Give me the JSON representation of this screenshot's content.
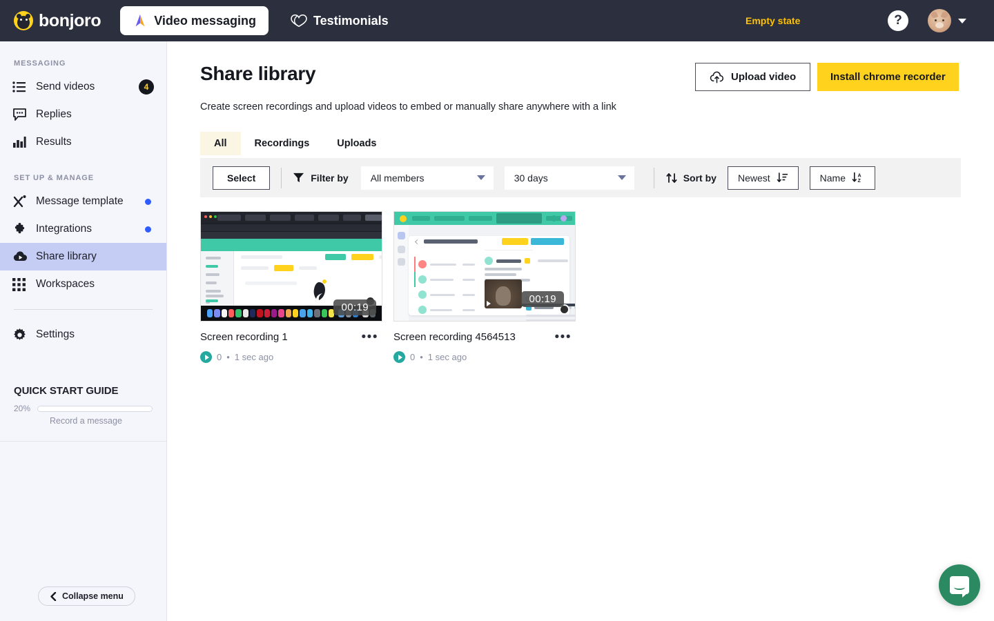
{
  "topbar": {
    "brand": "bonjoro",
    "nav": [
      {
        "label": "Video messaging",
        "icon": "paper-plane-icon",
        "active": true
      },
      {
        "label": "Testimonials",
        "icon": "heart-ribbon-icon",
        "active": false
      }
    ],
    "empty_state_link": "Empty state",
    "help_icon": "question-mark-icon",
    "avatar": "user-avatar",
    "caret": "chevron-down-icon",
    "bg_color": "#2b2f3e",
    "accent_color": "#ffc107"
  },
  "sidebar": {
    "sections": [
      {
        "title": "MESSAGING",
        "items": [
          {
            "label": "Send videos",
            "icon": "list-icon",
            "badge": "4",
            "dot": false,
            "active": false
          },
          {
            "label": "Replies",
            "icon": "chat-bubble-icon",
            "badge": null,
            "dot": false,
            "active": false
          },
          {
            "label": "Results",
            "icon": "bar-chart-icon",
            "badge": null,
            "dot": false,
            "active": false
          }
        ]
      },
      {
        "title": "SET UP & MANAGE",
        "items": [
          {
            "label": "Message template",
            "icon": "wand-icon",
            "badge": null,
            "dot": true,
            "active": false
          },
          {
            "label": "Integrations",
            "icon": "puzzle-icon",
            "badge": null,
            "dot": true,
            "active": false
          },
          {
            "label": "Share library",
            "icon": "cloud-play-icon",
            "badge": null,
            "dot": false,
            "active": true
          },
          {
            "label": "Workspaces",
            "icon": "grid-icon",
            "badge": null,
            "dot": false,
            "active": false
          }
        ]
      }
    ],
    "settings": {
      "label": "Settings",
      "icon": "gear-icon"
    },
    "quick_start": {
      "title": "QUICK START GUIDE",
      "percent_label": "20%",
      "percent_value": 20,
      "next_step": "Record a message"
    },
    "collapse": {
      "label": "Collapse menu",
      "icon": "chevron-left-icon"
    },
    "active_bg": "#c6cdf5",
    "bg_color": "#f5f6fb"
  },
  "main": {
    "page_title": "Share library",
    "page_subtitle": "Create screen recordings and upload videos to embed or manually share anywhere with a link",
    "upload_button": {
      "label": "Upload video",
      "icon": "cloud-upload-icon"
    },
    "install_button": {
      "label": "Install chrome recorder",
      "color": "#ffd21e"
    },
    "tabs": [
      {
        "label": "All",
        "active": true
      },
      {
        "label": "Recordings",
        "active": false
      },
      {
        "label": "Uploads",
        "active": false
      }
    ],
    "toolbar": {
      "select_label": "Select",
      "filter_label": "Filter by",
      "filter_icon": "funnel-icon",
      "members_select": {
        "value": "All members",
        "icon": "chevron-down-icon"
      },
      "days_select": {
        "value": "30 days",
        "icon": "chevron-down-icon"
      },
      "sort_label": "Sort by",
      "sort_icon": "sort-arrows-icon",
      "sort_newest": {
        "value": "Newest",
        "icon": "sort-descending-icon"
      },
      "sort_name": {
        "value": "Name",
        "icon": "sort-az-icon"
      }
    },
    "cards": [
      {
        "title": "Screen recording 1",
        "duration": "00:19",
        "plays": "0",
        "separator": "•",
        "time_ago": "1 sec ago",
        "menu_icon": "more-horizontal-icon",
        "play_icon": "play-icon"
      },
      {
        "title": "Screen recording 4564513",
        "duration": "00:19",
        "plays": "0",
        "separator": "•",
        "time_ago": "1 sec ago",
        "menu_icon": "more-horizontal-icon",
        "play_icon": "play-icon"
      }
    ]
  },
  "chat_widget": {
    "icon": "intercom-chat-icon",
    "color": "#2c8a63"
  }
}
